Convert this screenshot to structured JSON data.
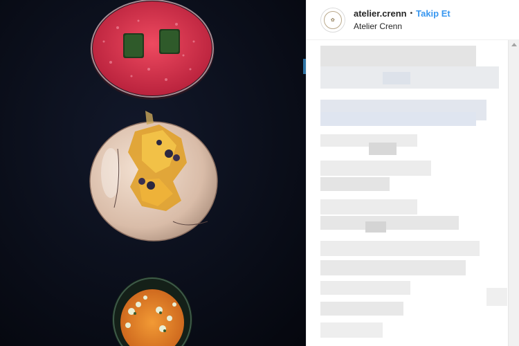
{
  "post": {
    "username": "atelier.crenn",
    "separator": "•",
    "follow_label": "Takip Et",
    "location": "Atelier Crenn",
    "avatar_icon": "atelier-crenn-logo",
    "photo_description_colors": {
      "background": "#0a0e1a",
      "beet_dish": "#d9304a",
      "plate": "#e8d3c2",
      "sea_urchin": "#e8882a",
      "follow_link": "#3897f0"
    }
  }
}
